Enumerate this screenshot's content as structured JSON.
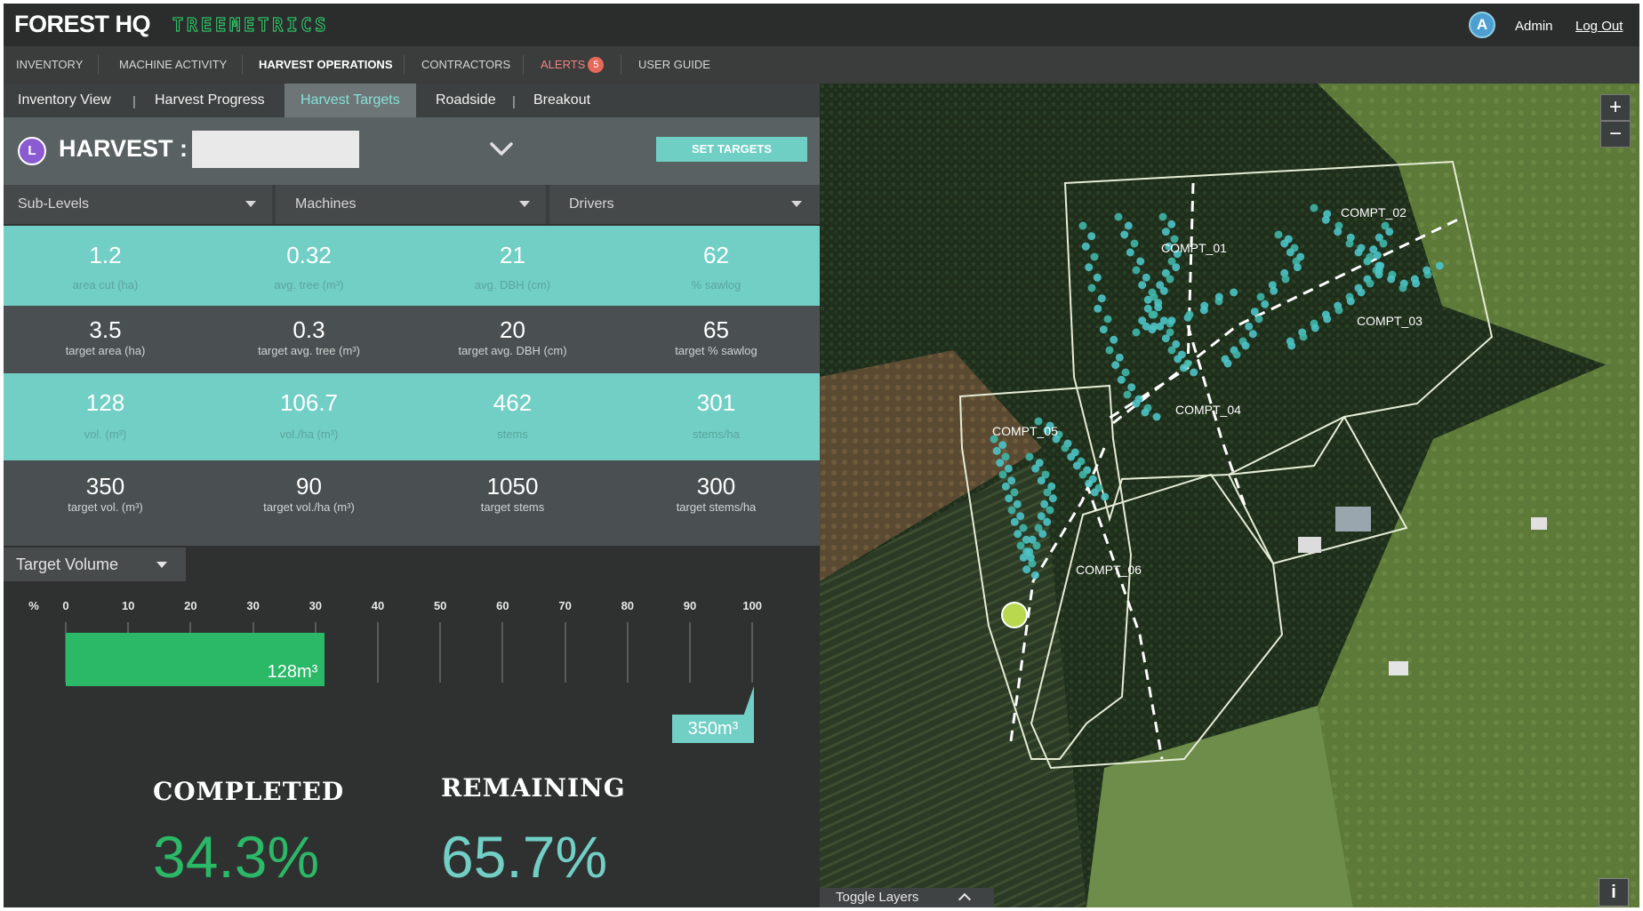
{
  "header": {
    "brand": "FOREST HQ",
    "brand_secondary": "TREEMETRICS",
    "user_initial": "A",
    "user_name": "Admin",
    "logout_label": "Log Out"
  },
  "main_nav": {
    "items": [
      {
        "label": "INVENTORY"
      },
      {
        "label": "MACHINE ACTIVITY"
      },
      {
        "label": "HARVEST OPERATIONS"
      },
      {
        "label": "CONTRACTORS"
      },
      {
        "label": "ALERTS"
      },
      {
        "label": "USER GUIDE"
      }
    ],
    "alerts_count": "5"
  },
  "sub_tabs": {
    "items": [
      {
        "label": "Inventory View"
      },
      {
        "label": "Harvest Progress"
      },
      {
        "label": "Harvest Targets"
      },
      {
        "label": "Roadside"
      },
      {
        "label": "Breakout"
      }
    ],
    "separator": "|"
  },
  "harvest": {
    "icon_letter": "L",
    "title": "HARVEST :",
    "set_targets_label": "SET TARGETS"
  },
  "filters": {
    "sublevels": "Sub-Levels",
    "machines": "Machines",
    "drivers": "Drivers"
  },
  "stats_rows": [
    [
      {
        "value": "1.2",
        "label": "area cut (ha)"
      },
      {
        "value": "0.32",
        "label": "avg. tree (m³)"
      },
      {
        "value": "21",
        "label": "avg. DBH (cm)"
      },
      {
        "value": "62",
        "label": "% sawlog"
      }
    ],
    [
      {
        "value": "3.5",
        "label": "target area (ha)"
      },
      {
        "value": "0.3",
        "label": "target avg. tree (m³)"
      },
      {
        "value": "20",
        "label": "target avg. DBH (cm)"
      },
      {
        "value": "65",
        "label": "target % sawlog"
      }
    ],
    [
      {
        "value": "128",
        "label": "vol. (m³)"
      },
      {
        "value": "106.7",
        "label": "vol./ha (m³)"
      },
      {
        "value": "462",
        "label": "stems"
      },
      {
        "value": "301",
        "label": "stems/ha"
      }
    ],
    [
      {
        "value": "350",
        "label": "target vol. (m³)"
      },
      {
        "value": "90",
        "label": "target vol./ha (m³)"
      },
      {
        "value": "1050",
        "label": "target stems"
      },
      {
        "value": "300",
        "label": "target stems/ha"
      }
    ]
  ],
  "target_volume": {
    "dropdown_label": "Target Volume",
    "axis_unit": "%",
    "tick_labels": [
      "0",
      "10",
      "20",
      "30",
      "30",
      "40",
      "50",
      "60",
      "70",
      "80",
      "90",
      "100"
    ],
    "progress_fraction": 0.343,
    "completed_value_label": "128m³",
    "target_value_label": "350m³"
  },
  "summary": {
    "completed_title": "COMPLETED",
    "completed_value": "34.3%",
    "remaining_title": "REMAINING",
    "remaining_value": "65.7%",
    "completed_color": "#2bb867",
    "remaining_color": "#72cfc5"
  },
  "map": {
    "zoom_in": "+",
    "zoom_out": "−",
    "toggle_layers_label": "Toggle Layers",
    "info_label": "i",
    "compartments": [
      "COMPT_01",
      "COMPT_02",
      "COMPT_03",
      "COMPT_04",
      "COMPT_05",
      "COMPT_06"
    ]
  },
  "colors": {
    "accent_teal": "#72cfc5",
    "accent_green": "#2bb867",
    "alert_red": "#e8685a"
  }
}
